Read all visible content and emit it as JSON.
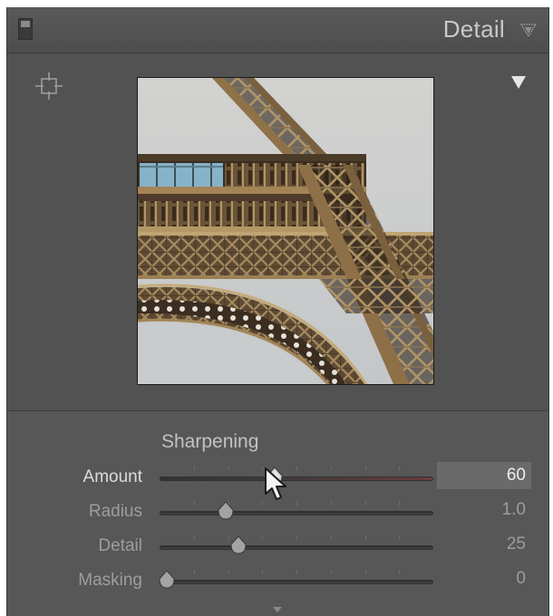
{
  "panel": {
    "title": "Detail"
  },
  "sharpening": {
    "title": "Sharpening",
    "sliders": [
      {
        "label": "Amount",
        "value": "60",
        "fraction": 0.4167,
        "active": true
      },
      {
        "label": "Radius",
        "value": "1.0",
        "fraction": 0.2286,
        "active": false
      },
      {
        "label": "Detail",
        "value": "25",
        "fraction": 0.2778,
        "active": false
      },
      {
        "label": "Masking",
        "value": "0",
        "fraction": 0.0,
        "active": false
      }
    ]
  },
  "colors": {
    "panel_bg": "#525252",
    "header_text": "#c9c9c9",
    "active_value_bg": "#6a6a6a"
  },
  "icons": {
    "target_adjustment": "crosshair-target-icon",
    "panel_collapse": "triangle-down-icon",
    "preview_menu": "triangle-down-icon",
    "solo": "panel-switch-icon",
    "cursor": "arrow-cursor-icon"
  }
}
